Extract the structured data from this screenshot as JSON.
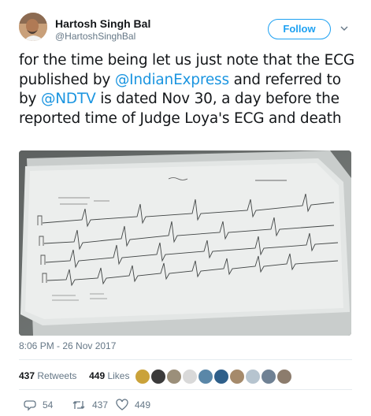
{
  "author": {
    "name": "Hartosh Singh Bal",
    "handle": "@HartoshSinghBal"
  },
  "follow_label": "Follow",
  "tweet": {
    "part1": "for the time being let us just note that the ECG published by ",
    "mention1": "@IndianExpress",
    "part2": " and referred to by ",
    "mention2": "@NDTV",
    "part3": " is dated Nov 30, a day before the reported time of Judge Loya's ECG and death"
  },
  "timestamp": "8:06 PM - 26 Nov 2017",
  "stats": {
    "retweets_count": "437",
    "retweets_label": "Retweets",
    "likes_count": "449",
    "likes_label": "Likes"
  },
  "liker_avatar_colors": [
    "#caa23a",
    "#3b3b3b",
    "#9b8f7a",
    "#d9d9d9",
    "#5a87a8",
    "#2e5f8a",
    "#a58a6b",
    "#b6c4cf",
    "#6f8194",
    "#8c7c6d"
  ],
  "actions": {
    "replies": "54",
    "retweets": "437",
    "likes": "449"
  },
  "colors": {
    "accent": "#1da1f2",
    "link": "#1b95e0",
    "muted": "#657786"
  }
}
